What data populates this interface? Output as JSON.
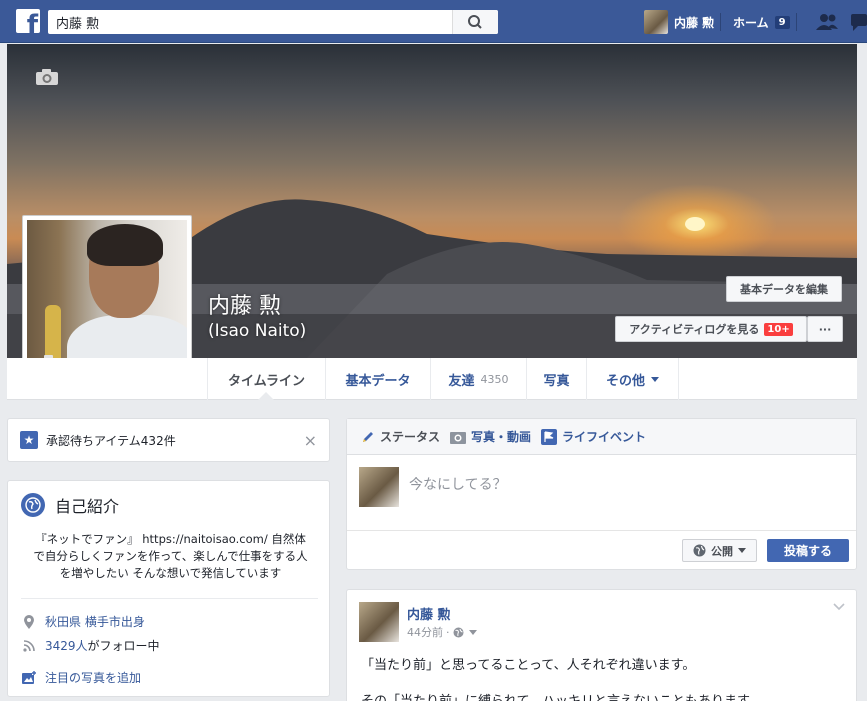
{
  "topbar": {
    "logo_letter": "f",
    "search_value": "内藤 勲",
    "user_name": "内藤 勲",
    "home_label": "ホーム",
    "home_count": "9"
  },
  "cover": {
    "name": "内藤 勲",
    "alt_name": "(Isao Naito)",
    "edit_button": "基本データを編集",
    "activity_button": "アクティビティログを見る",
    "activity_badge": "10+",
    "more_button": "···"
  },
  "nav": {
    "tabs": [
      {
        "label": "タイムライン"
      },
      {
        "label": "基本データ"
      },
      {
        "label": "友達",
        "count": "4350"
      },
      {
        "label": "写真"
      },
      {
        "label": "その他"
      }
    ]
  },
  "pending": {
    "text": "承認待ちアイテム432件",
    "close": "×"
  },
  "intro": {
    "title": "自己紹介",
    "bio": "『ネットでファン』 https://naitoisao.com/ 自然体で自分らしくファンを作って、楽しんで仕事をする人を増やしたい そんな想いで発信しています",
    "hometown": "秋田県 横手市出身",
    "followers_link": "3429人",
    "followers_suffix": "がフォロー中",
    "add_photo": "注目の写真を追加"
  },
  "composer": {
    "tabs": [
      "ステータス",
      "写真・動画",
      "ライフイベント"
    ],
    "placeholder": "今なにしてる？",
    "privacy": "公開",
    "post_button": "投稿する"
  },
  "post": {
    "author": "内藤 勲",
    "time": "44分前",
    "dot": "·",
    "text1": "「当たり前」と思ってることって、人それぞれ違います。",
    "text2": "その「当たり前」に縛られて、ハッキリと言えないこともあります。"
  },
  "colors": {
    "brand": "#3b5998",
    "link": "#365899",
    "primary_button": "#4267b2",
    "badge_red": "#fa3e3e"
  }
}
